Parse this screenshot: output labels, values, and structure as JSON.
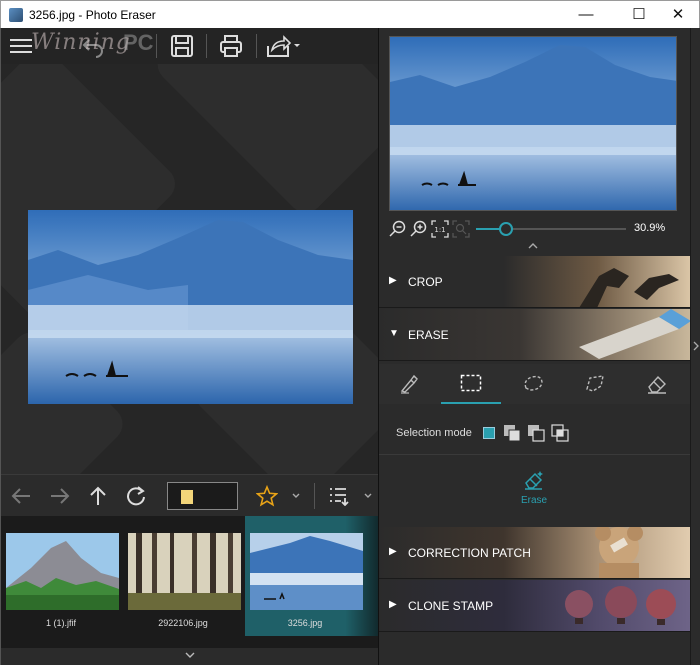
{
  "window": {
    "title": "3256.jpg - Photo Eraser",
    "minimize": "—",
    "maximize": "☐",
    "close": "✕"
  },
  "watermark": {
    "part1": "Winning",
    "part2": "PC"
  },
  "icons": {
    "menu": "hamburger-icon",
    "undo": "undo-icon",
    "save": "save-icon",
    "print": "print-icon",
    "share": "share-icon",
    "back": "back-arrow-icon",
    "forward": "forward-arrow-icon",
    "up": "up-arrow-icon",
    "refresh": "refresh-icon",
    "favorite": "star-icon",
    "sort": "sort-list-icon"
  },
  "colors": {
    "accent": "#2aa0b0",
    "star": "#e8a317",
    "folder": "#f3d57a"
  },
  "thumbnails": [
    {
      "name": "1 (1).jfif"
    },
    {
      "name": "2922106.jpg"
    },
    {
      "name": "3256.jpg",
      "selected": true
    }
  ],
  "zoom": {
    "value": "30.9%",
    "slider_fraction": 0.2
  },
  "panels": {
    "crop": "CROP",
    "erase": "ERASE",
    "correction_patch": "CORRECTION PATCH",
    "clone_stamp": "CLONE STAMP"
  },
  "erase": {
    "selection_mode_label": "Selection mode",
    "erase_button": "Erase",
    "active_tool_index": 1
  }
}
